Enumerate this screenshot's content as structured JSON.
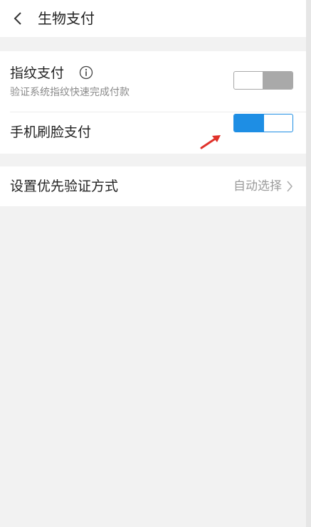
{
  "header": {
    "back_icon": "chevron-left-icon",
    "title": "生物支付"
  },
  "biometric": {
    "fingerprint": {
      "title": "指纹支付",
      "info_icon": "info-icon",
      "subtitle": "验证系统指纹快速完成付款",
      "enabled": false
    },
    "face": {
      "title": "手机刷脸支付",
      "enabled": true
    }
  },
  "verify_method": {
    "label": "设置优先验证方式",
    "value": "自动选择",
    "chevron_icon": "chevron-right-icon"
  },
  "colors": {
    "accent": "#1e8ee4",
    "toggle_off": "#a9a9a9",
    "annotation_arrow": "#e0322b",
    "background": "#f2f2f2"
  }
}
